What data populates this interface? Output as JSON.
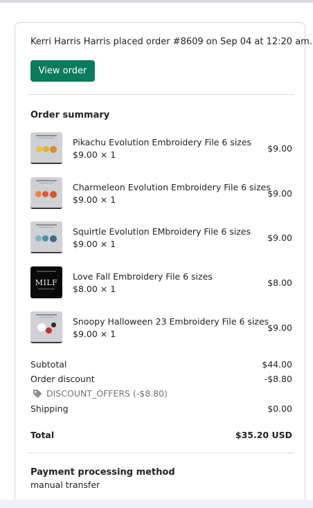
{
  "notification": {
    "headline": "Kerri Harris Harris placed order #8609 on Sep 04 at 12:20 am.",
    "view_order_label": "View order"
  },
  "order_summary": {
    "title": "Order summary",
    "items": [
      {
        "title": "Pikachu Evolution Embroidery File 6 sizes",
        "qty": "$9.00 × 1",
        "price": "$9.00",
        "thumb_colors": [
          "#e7c53a",
          "#e2b32b",
          "#d98e2a"
        ]
      },
      {
        "title": "Charmeleon Evolution Embroidery File 6 sizes",
        "qty": "$9.00 × 1",
        "price": "$9.00",
        "thumb_colors": [
          "#e8873d",
          "#d9573a",
          "#c65a31"
        ]
      },
      {
        "title": "Squirtle Evolution EMbroidery File 6 sizes",
        "qty": "$9.00 × 1",
        "price": "$9.00",
        "thumb_colors": [
          "#7fb8c9",
          "#4e8fa8",
          "#3f6c86"
        ]
      },
      {
        "title": "Love Fall Embroidery File 6 sizes",
        "qty": "$8.00 × 1",
        "price": "$8.00",
        "thumb_text": "MILF"
      },
      {
        "title": "Snoopy Halloween 23 Embroidery File 6 sizes",
        "qty": "$9.00 × 1",
        "price": "$9.00",
        "thumb_colors": [
          "#ffffff",
          "#c2352c",
          "#2b2b2b"
        ]
      }
    ]
  },
  "totals": {
    "subtotal_label": "Subtotal",
    "subtotal_value": "$44.00",
    "discount_label": "Order discount",
    "discount_value": "-$8.80",
    "discount_code": "DISCOUNT_OFFERS (-$8.80)",
    "discount_icon": "tag-icon",
    "shipping_label": "Shipping",
    "shipping_value": "$0.00",
    "total_label": "Total",
    "total_value": "$35.20 USD"
  },
  "payment": {
    "title": "Payment processing method",
    "method": "manual transfer"
  },
  "colors": {
    "button": "#0b7b5d",
    "muted_text": "#6d7175",
    "border": "#d2d5d9"
  }
}
